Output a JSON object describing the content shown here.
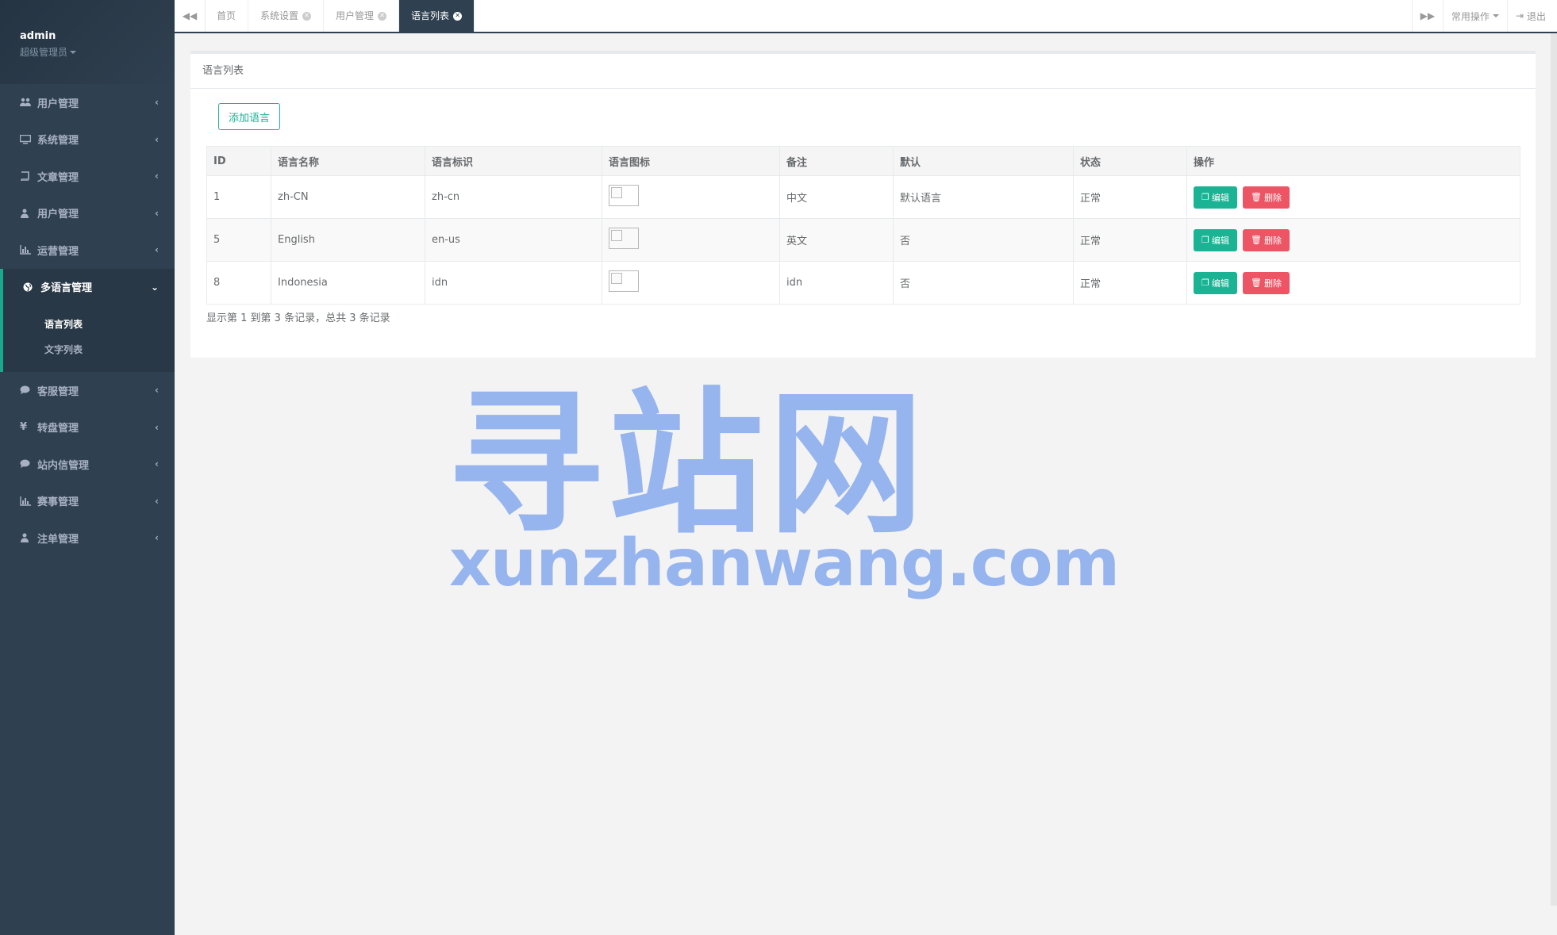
{
  "profile": {
    "name": "admin",
    "role": "超级管理员"
  },
  "sidebar": {
    "items": [
      {
        "label": "用户管理",
        "icon": "users-icon"
      },
      {
        "label": "系统管理",
        "icon": "desktop-icon"
      },
      {
        "label": "文章管理",
        "icon": "book-icon"
      },
      {
        "label": "用户管理",
        "icon": "user-icon"
      },
      {
        "label": "运营管理",
        "icon": "bar-chart-icon"
      },
      {
        "label": "多语言管理",
        "icon": "globe-icon"
      },
      {
        "label": "客服管理",
        "icon": "comment-icon"
      },
      {
        "label": "转盘管理",
        "icon": "yen-icon"
      },
      {
        "label": "站内信管理",
        "icon": "comment-icon"
      },
      {
        "label": "赛事管理",
        "icon": "bar-chart-icon"
      },
      {
        "label": "注单管理",
        "icon": "user-icon"
      }
    ],
    "submenu": [
      "语言列表",
      "文字列表"
    ]
  },
  "tabs": [
    "首页",
    "系统设置",
    "用户管理",
    "语言列表"
  ],
  "toolbar": {
    "common_ops": "常用操作",
    "logout": "退出"
  },
  "panel": {
    "title": "语言列表",
    "add_button": "添加语言",
    "columns": [
      "ID",
      "语言名称",
      "语言标识",
      "语言图标",
      "备注",
      "默认",
      "状态",
      "操作"
    ],
    "rows": [
      {
        "id": "1",
        "name": "zh-CN",
        "code": "zh-cn",
        "remark": "中文",
        "default": "默认语言",
        "status": "正常"
      },
      {
        "id": "5",
        "name": "English",
        "code": "en-us",
        "remark": "英文",
        "default": "否",
        "status": "正常"
      },
      {
        "id": "8",
        "name": "Indonesia",
        "code": "idn",
        "remark": "idn",
        "default": "否",
        "status": "正常"
      }
    ],
    "edit_label": "编辑",
    "delete_label": "删除",
    "pager": "显示第 1 到第 3 条记录，总共 3 条记录"
  },
  "watermark": {
    "cn": "寻站网",
    "en": "xunzhanwang.com"
  },
  "colors": {
    "sidebar": "#2f4050",
    "accent": "#1ab394",
    "danger": "#ed5565",
    "watermark": "#8fb0ee"
  }
}
